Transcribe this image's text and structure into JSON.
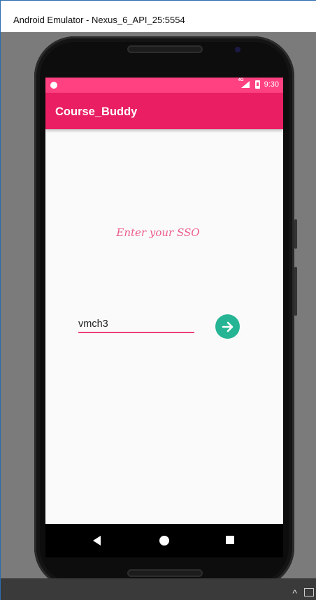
{
  "window": {
    "title": "Android Emulator - Nexus_6_API_25:5554"
  },
  "status_bar": {
    "time": "9:30",
    "network": "4G"
  },
  "app_bar": {
    "title": "Course_Buddy"
  },
  "main": {
    "prompt": "Enter your SSO",
    "sso_input": {
      "value": "vmch3"
    },
    "submit_icon": "arrow-right-icon"
  },
  "nav_bar": {
    "icons": [
      "back-icon",
      "home-icon",
      "recents-icon"
    ]
  },
  "colors": {
    "status_bar": "#ff4081",
    "app_bar": "#e91e63",
    "accent": "#ec407a",
    "submit_button": "#26b594"
  }
}
